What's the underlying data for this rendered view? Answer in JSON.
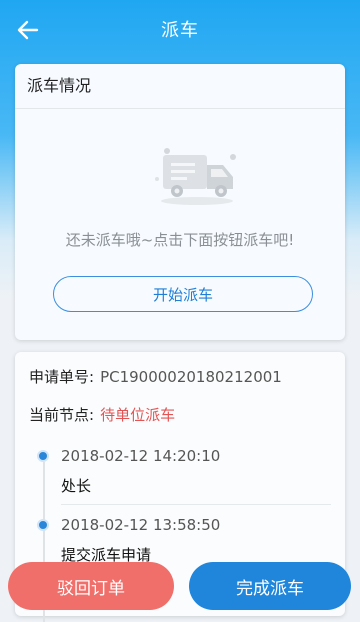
{
  "header": {
    "title": "派车"
  },
  "dispatch": {
    "section_title": "派车情况",
    "empty_text": "还未派车哦~点击下面按钮派车吧!",
    "start_button": "开始派车"
  },
  "application": {
    "order_label": "申请单号:",
    "order_value": "PC19000020180212001",
    "node_label": "当前节点:",
    "node_value": "待单位派车",
    "timeline": [
      {
        "time": "2018-02-12 14:20:10",
        "desc": "处长"
      },
      {
        "time": "2018-02-12 13:58:50",
        "desc": "提交派车申请"
      }
    ]
  },
  "actions": {
    "reject": "驳回订单",
    "complete": "完成派车"
  },
  "colors": {
    "primary": "#1f86dc",
    "danger": "#f06f6a",
    "node_status": "#e35454"
  }
}
